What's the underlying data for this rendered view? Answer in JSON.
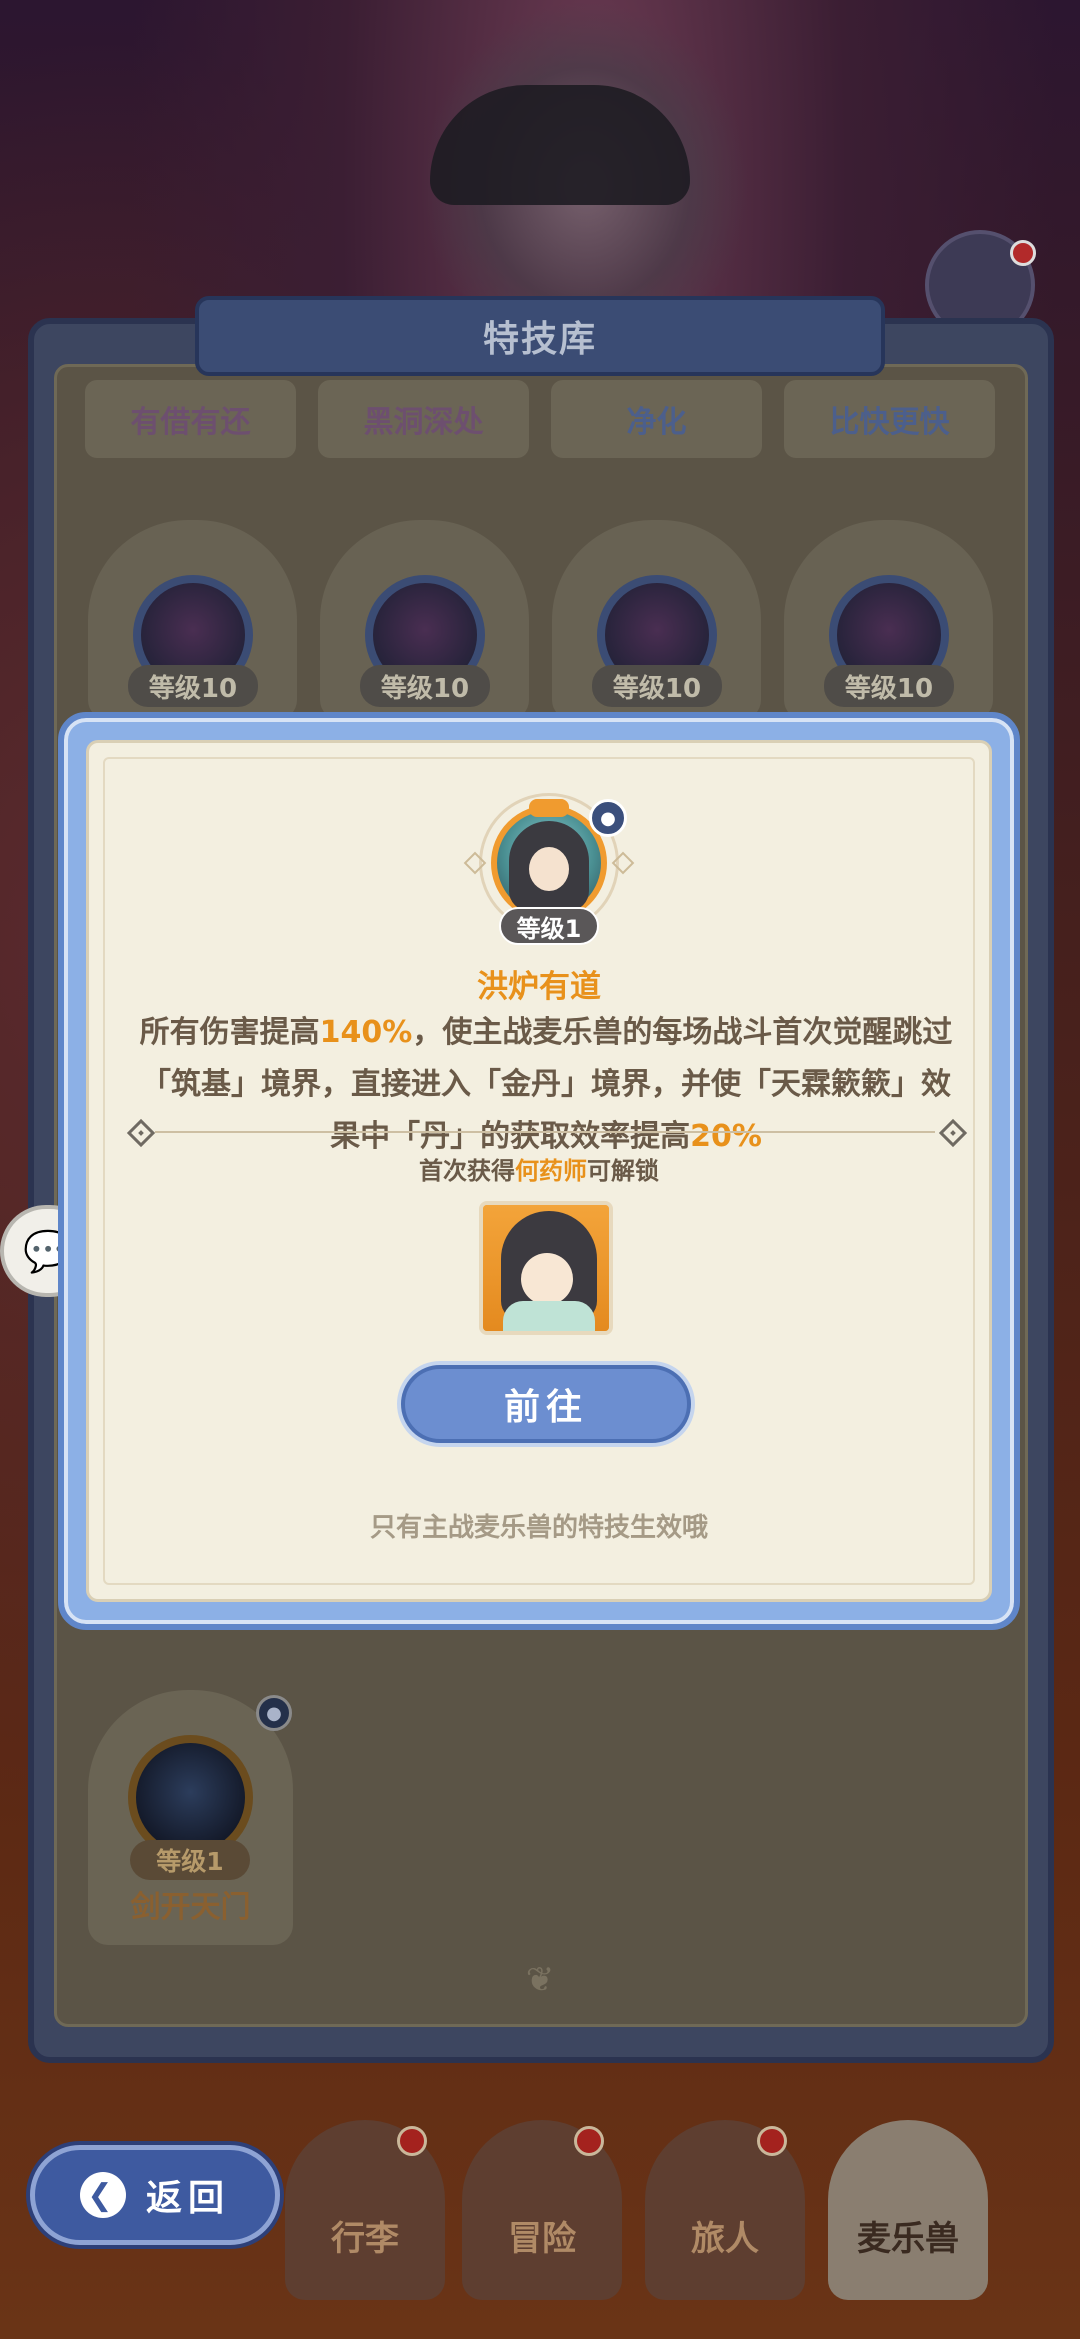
{
  "library": {
    "title": "特技库",
    "tabs": [
      "有借有还",
      "黑洞深处",
      "净化",
      "比快更快"
    ],
    "cards": [
      {
        "level": "等级10"
      },
      {
        "level": "等级10"
      },
      {
        "level": "等级10"
      },
      {
        "level": "等级10"
      }
    ],
    "owned_card": {
      "level": "等级1",
      "name": "剑开天门"
    }
  },
  "modal": {
    "level": "等级1",
    "title": "洪炉有道",
    "desc": {
      "p1": "所有伤害提高",
      "v1": "140%",
      "p2": "，使主战麦乐兽的每场战斗首次觉醒跳过「筑基」境界，直接进入「金丹」境界，并使「天霖簌簌」效果中「丹」的获取效率提高",
      "v2": "20%"
    },
    "unlock": {
      "prefix": "首次获得",
      "name": "何药师",
      "suffix": "可解锁"
    },
    "go_button": "前往",
    "footnote": "只有主战麦乐兽的特技生效哦"
  },
  "nav": {
    "back": "返回",
    "items": [
      "行李",
      "冒险",
      "旅人",
      "麦乐兽"
    ]
  },
  "icons": {
    "chat": "chat-bubbles-icon",
    "lock": "lock-icon",
    "back": "chevron-left-icon"
  },
  "colors": {
    "accent_orange": "#e8911b",
    "modal_blue": "#8cb0e6",
    "button_blue": "#6c8ed0"
  }
}
